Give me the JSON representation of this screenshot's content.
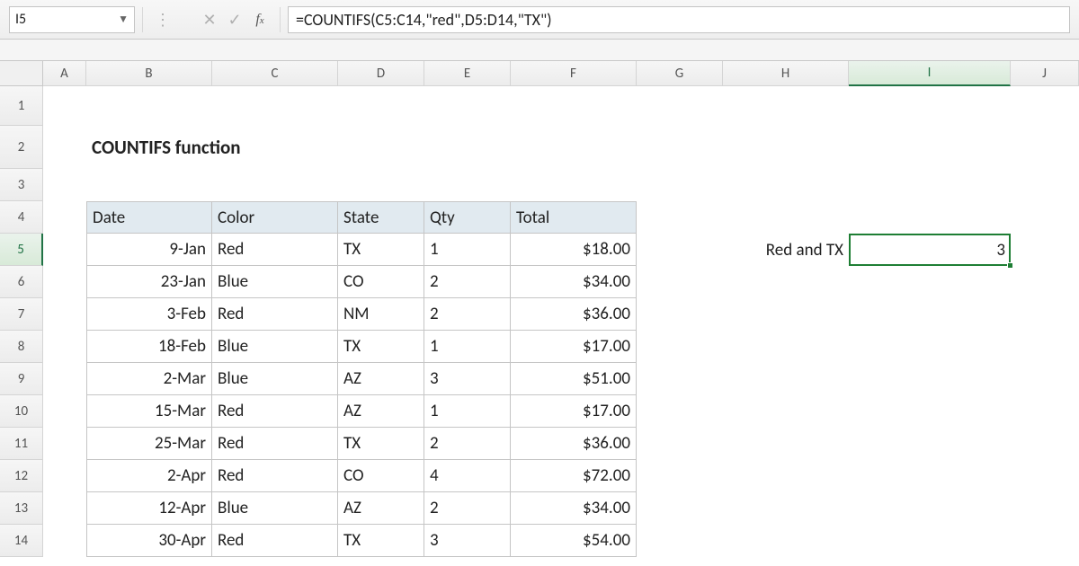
{
  "formula_bar": {
    "cell_ref": "I5",
    "formula": "=COUNTIFS(C5:C14,\"red\",D5:D14,\"TX\")"
  },
  "columns": [
    "A",
    "B",
    "C",
    "D",
    "E",
    "F",
    "G",
    "H",
    "I",
    "J"
  ],
  "rows": [
    "1",
    "2",
    "3",
    "4",
    "5",
    "6",
    "7",
    "8",
    "9",
    "10",
    "11",
    "12",
    "13",
    "14"
  ],
  "title": "COUNTIFS function",
  "headers": {
    "date": "Date",
    "color": "Color",
    "state": "State",
    "qty": "Qty",
    "total": "Total"
  },
  "table": {
    "rows": [
      {
        "date": "9-Jan",
        "color": "Red",
        "state": "TX",
        "qty": "1",
        "total": "$18.00"
      },
      {
        "date": "23-Jan",
        "color": "Blue",
        "state": "CO",
        "qty": "2",
        "total": "$34.00"
      },
      {
        "date": "3-Feb",
        "color": "Red",
        "state": "NM",
        "qty": "2",
        "total": "$36.00"
      },
      {
        "date": "18-Feb",
        "color": "Blue",
        "state": "TX",
        "qty": "1",
        "total": "$17.00"
      },
      {
        "date": "2-Mar",
        "color": "Blue",
        "state": "AZ",
        "qty": "3",
        "total": "$51.00"
      },
      {
        "date": "15-Mar",
        "color": "Red",
        "state": "AZ",
        "qty": "1",
        "total": "$17.00"
      },
      {
        "date": "25-Mar",
        "color": "Red",
        "state": "TX",
        "qty": "2",
        "total": "$36.00"
      },
      {
        "date": "2-Apr",
        "color": "Red",
        "state": "CO",
        "qty": "4",
        "total": "$72.00"
      },
      {
        "date": "12-Apr",
        "color": "Blue",
        "state": "AZ",
        "qty": "2",
        "total": "$34.00"
      },
      {
        "date": "30-Apr",
        "color": "Red",
        "state": "TX",
        "qty": "3",
        "total": "$54.00"
      }
    ]
  },
  "result": {
    "label": "Red and TX",
    "value": "3"
  },
  "chart_data": {
    "type": "table",
    "title": "COUNTIFS function",
    "columns": [
      "Date",
      "Color",
      "State",
      "Qty",
      "Total"
    ],
    "rows": [
      [
        "9-Jan",
        "Red",
        "TX",
        1,
        18.0
      ],
      [
        "23-Jan",
        "Blue",
        "CO",
        2,
        34.0
      ],
      [
        "3-Feb",
        "Red",
        "NM",
        2,
        36.0
      ],
      [
        "18-Feb",
        "Blue",
        "TX",
        1,
        17.0
      ],
      [
        "2-Mar",
        "Blue",
        "AZ",
        3,
        51.0
      ],
      [
        "15-Mar",
        "Red",
        "AZ",
        1,
        17.0
      ],
      [
        "25-Mar",
        "Red",
        "TX",
        2,
        36.0
      ],
      [
        "2-Apr",
        "Red",
        "CO",
        4,
        72.0
      ],
      [
        "12-Apr",
        "Blue",
        "AZ",
        2,
        34.0
      ],
      [
        "30-Apr",
        "Red",
        "TX",
        3,
        54.0
      ]
    ],
    "formula": "=COUNTIFS(C5:C14,\"red\",D5:D14,\"TX\")",
    "result": 3
  }
}
